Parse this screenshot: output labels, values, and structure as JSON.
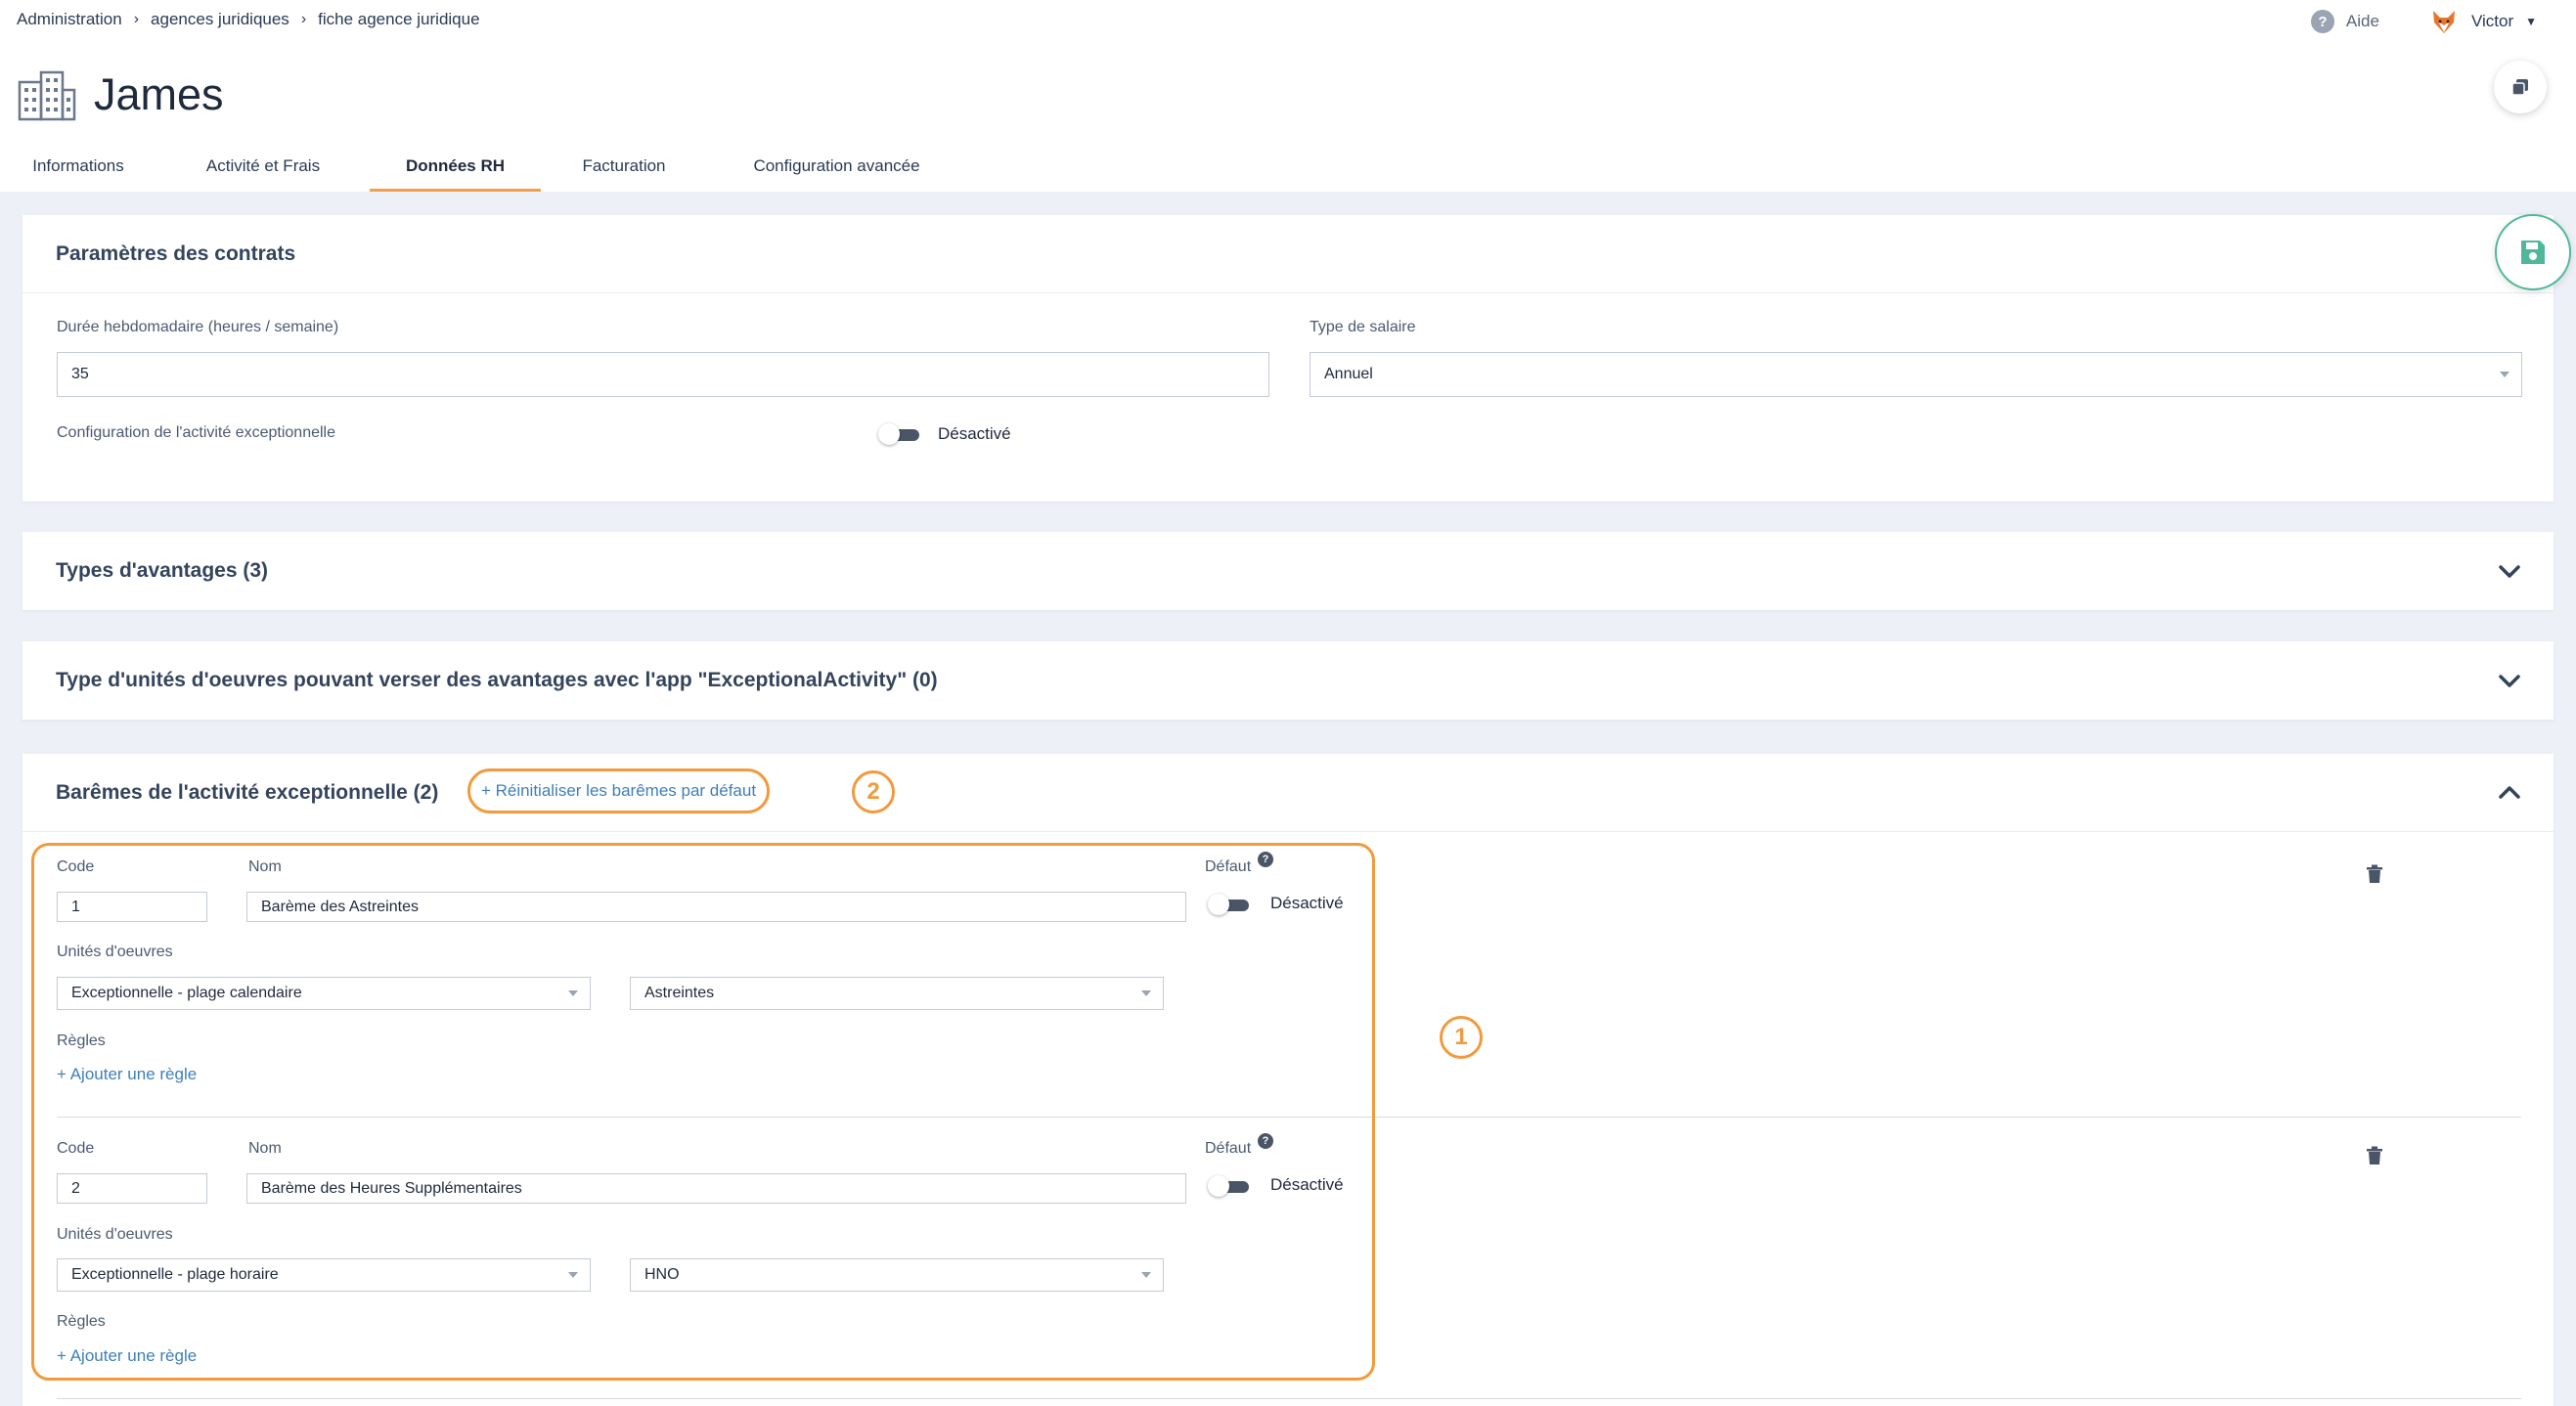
{
  "breadcrumb": [
    "Administration",
    "agences juridiques",
    "fiche agence juridique"
  ],
  "header": {
    "help_label": "Aide",
    "user_name": "Victor",
    "page_title": "James"
  },
  "tabs": [
    {
      "label": "Informations",
      "active": false
    },
    {
      "label": "Activité et Frais",
      "active": false
    },
    {
      "label": "Données RH",
      "active": true
    },
    {
      "label": "Facturation",
      "active": false
    },
    {
      "label": "Configuration avancée",
      "active": false
    }
  ],
  "contract_params": {
    "title": "Paramètres des contrats",
    "weekly_hours_label": "Durée hebdomadaire (heures / semaine)",
    "weekly_hours_value": "35",
    "salary_type_label": "Type de salaire",
    "salary_type_value": "Annuel",
    "exceptional_config_label": "Configuration de l'activité exceptionnelle",
    "exceptional_config_state": "Désactivé"
  },
  "benefits_section": {
    "title": "Types d'avantages (3)"
  },
  "work_units_section": {
    "title": "Type d'unités d'oeuvres pouvant verser des avantages avec l'app \"ExceptionalActivity\" (0)"
  },
  "scales_section": {
    "title": "Barêmes de l'activité exceptionnelle (2)",
    "reset_link": "+ Réinitialiser les barêmes par défaut",
    "annotation_2": "2",
    "annotation_1": "1",
    "code_label": "Code",
    "name_label": "Nom",
    "default_label": "Défaut",
    "units_label": "Unités d'oeuvres",
    "rules_label": "Règles",
    "add_rule": "+ Ajouter une règle",
    "disabled_label": "Désactivé",
    "items": [
      {
        "code": "1",
        "name": "Barème des Astreintes",
        "unit_type": "Exceptionnelle - plage calendaire",
        "unit": "Astreintes"
      },
      {
        "code": "2",
        "name": "Barème des Heures Supplémentaires",
        "unit_type": "Exceptionnelle - plage horaire",
        "unit": "HNO"
      }
    ]
  },
  "colors": {
    "accent_orange": "#f29a3d",
    "link_blue": "#3f7fb8",
    "save_green": "#4fb89a",
    "background": "#edf0f6"
  }
}
